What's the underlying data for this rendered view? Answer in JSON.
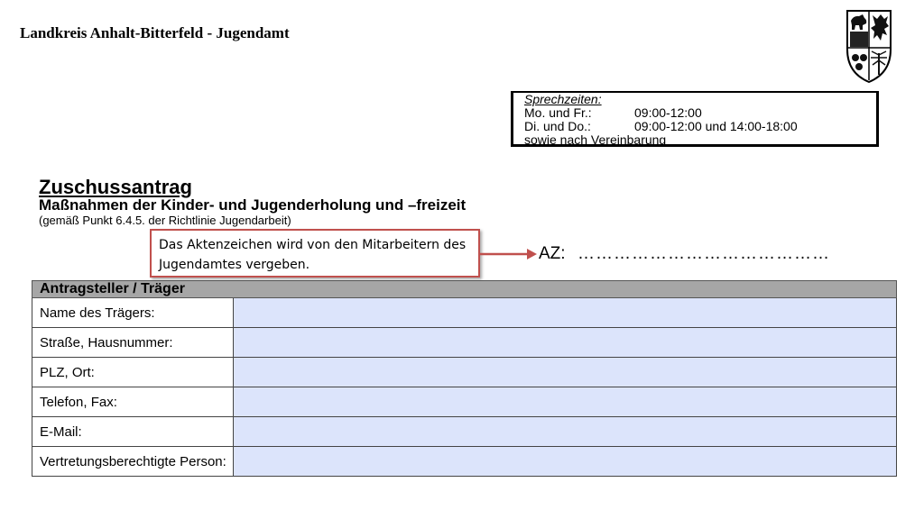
{
  "header": {
    "title": "Landkreis Anhalt-Bitterfeld - Jugendamt"
  },
  "office_hours": {
    "heading": "Sprechzeiten:",
    "rows": [
      {
        "days": "Mo. und Fr.:",
        "times": "09:00-12:00"
      },
      {
        "days": "Di. und Do.:",
        "times": "09:00-12:00 und 14:00-18:00"
      }
    ],
    "note": "sowie nach Vereinbarung"
  },
  "document": {
    "title": "Zuschussantrag",
    "subtitle": "Maßnahmen der Kinder- und Jugenderholung und –freizeit",
    "note": "(gemäß Punkt 6.4.5. der Richtlinie Jugendarbeit)"
  },
  "callout": {
    "text": "Das Aktenzeichen wird von den Mitarbeitern des Jugendamtes vergeben."
  },
  "az": {
    "label": "AZ:",
    "dots": "……………………………………"
  },
  "form": {
    "section_title": "Antragsteller / Träger",
    "fields": [
      {
        "label": "Name des Trägers:",
        "value": ""
      },
      {
        "label": "Straße, Hausnummer:",
        "value": ""
      },
      {
        "label": "PLZ, Ort:",
        "value": ""
      },
      {
        "label": "Telefon, Fax:",
        "value": ""
      },
      {
        "label": "E-Mail:",
        "value": ""
      },
      {
        "label": "Vertretungsberechtigte Person:",
        "value": ""
      }
    ]
  },
  "colors": {
    "field_fill": "#dce4fb",
    "section_fill": "#a6a6a6",
    "callout_border": "#c0504d"
  },
  "icons": {
    "crest": "coat-of-arms-icon"
  }
}
